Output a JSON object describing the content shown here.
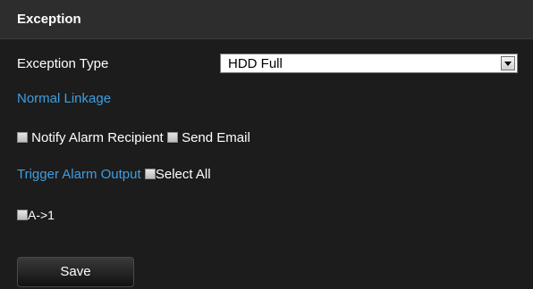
{
  "header": {
    "title": "Exception"
  },
  "exception_type": {
    "label": "Exception Type",
    "value": "HDD Full"
  },
  "normal_linkage": {
    "label": "Normal Linkage"
  },
  "linkage": {
    "notify_label": "Notify Alarm Recipient",
    "email_label": "Send Email"
  },
  "trigger": {
    "label": "Trigger Alarm Output",
    "select_all_label": "Select All"
  },
  "outputs": [
    {
      "label": "A->1"
    }
  ],
  "actions": {
    "save_label": "Save"
  }
}
